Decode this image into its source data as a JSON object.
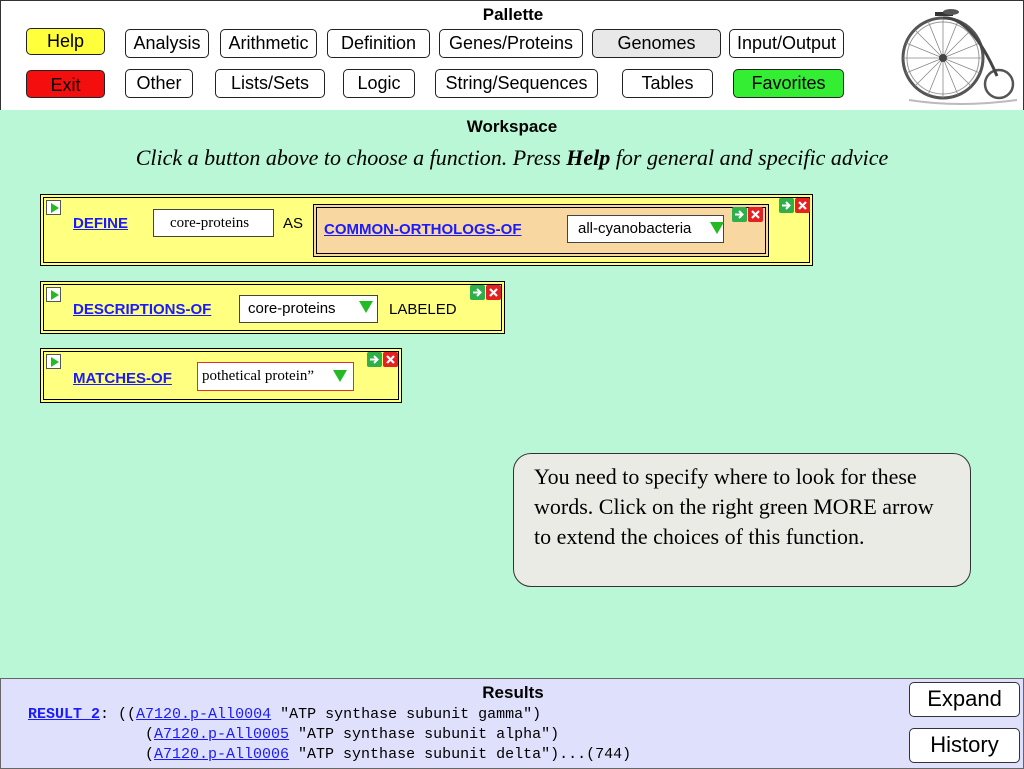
{
  "palette": {
    "title": "Pallette",
    "buttons": {
      "help": "Help",
      "exit": "Exit",
      "analysis": "Analysis",
      "arithmetic": "Arithmetic",
      "definition": "Definition",
      "genes_proteins": "Genes/Proteins",
      "genomes": "Genomes",
      "input_output": "Input/Output",
      "other": "Other",
      "lists_sets": "Lists/Sets",
      "logic": "Logic",
      "string_sequences": "String/Sequences",
      "tables": "Tables",
      "favorites": "Favorites"
    },
    "logo_icon": "penny-farthing-bicycle-icon"
  },
  "workspace": {
    "title": "Workspace",
    "instruction_before": "Click a button above to choose a function. Press ",
    "instruction_bold": "Help",
    "instruction_after": " for general and specific advice",
    "define_box": {
      "function": "DEFINE",
      "name_value": "core-proteins",
      "keyword": "AS",
      "nested": {
        "function": "COMMON-ORTHOLOGS-OF",
        "arg_value": "all-cyanobacteria"
      }
    },
    "descriptions_box": {
      "function": "DESCRIPTIONS-OF",
      "arg_value": "core-proteins",
      "keyword": "LABELED"
    },
    "matches_box": {
      "function": "MATCHES-OF",
      "arg_value": "pothetical protein”"
    },
    "hint": "You need to specify where to look for these words. Click on the right green MORE arrow to extend the choices of this function."
  },
  "results": {
    "title": "Results",
    "label": "RESULT 2",
    "colon": ":",
    "rows": [
      {
        "prefix": " ((",
        "id": "A7120.p-All0004",
        "desc": " \"ATP synthase subunit gamma\")",
        "suffix": ""
      },
      {
        "prefix": "(",
        "id": "A7120.p-All0005",
        "desc": " \"ATP synthase subunit alpha\")",
        "suffix": ""
      },
      {
        "prefix": "(",
        "id": "A7120.p-All0006",
        "desc": " \"ATP synthase subunit delta\")",
        "suffix": "...(744)"
      }
    ],
    "expand_label": "Expand",
    "history_label": "History"
  },
  "colors": {
    "workspace_bg": "#b9f7d6",
    "box_bg": "#ffff80",
    "link": "#1a1aff",
    "help_btn": "#ffff3c",
    "exit_btn": "#f40e0e",
    "favorites_btn": "#33ee33",
    "results_bg": "#dfe0fb"
  }
}
